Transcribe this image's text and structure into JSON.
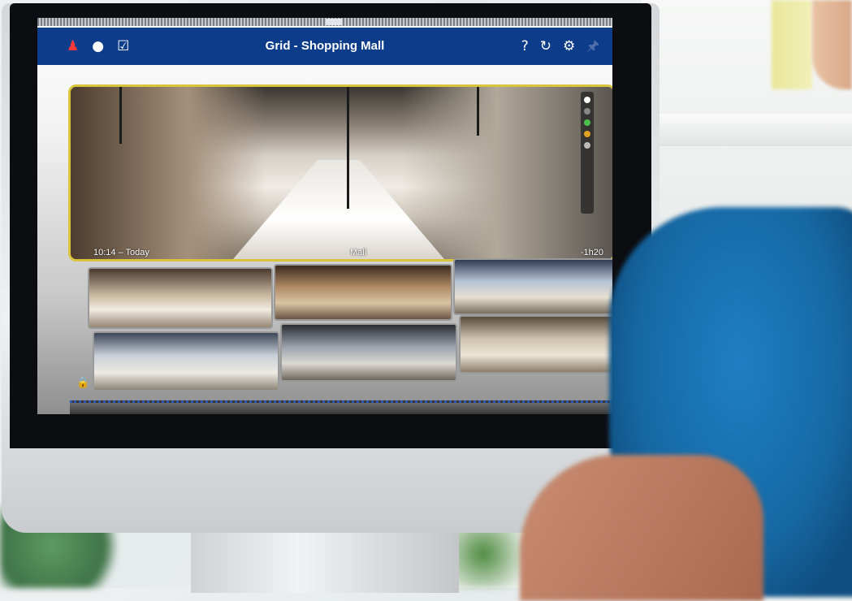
{
  "app": {
    "title": "Grid - Shopping Mall"
  },
  "toolbar": {
    "left_icons": [
      "user-alarm-icon",
      "chat-bubble-icon",
      "checkbox-icon"
    ],
    "right_icons": [
      "help-icon",
      "refresh-icon",
      "settings-icon",
      "pin-icon"
    ]
  },
  "main_camera": {
    "time_label": "10:14 – Today",
    "name_label": "Mall",
    "offset_label": "-1h20"
  },
  "thumbnails": [
    {
      "name": "camera-1"
    },
    {
      "name": "camera-2"
    },
    {
      "name": "camera-3"
    },
    {
      "name": "camera-4"
    },
    {
      "name": "camera-5"
    },
    {
      "name": "camera-6"
    }
  ],
  "colors": {
    "appbar": "#0d3d8a",
    "selected_border": "#d9c53d",
    "alarm_icon": "#ff3a3a"
  }
}
